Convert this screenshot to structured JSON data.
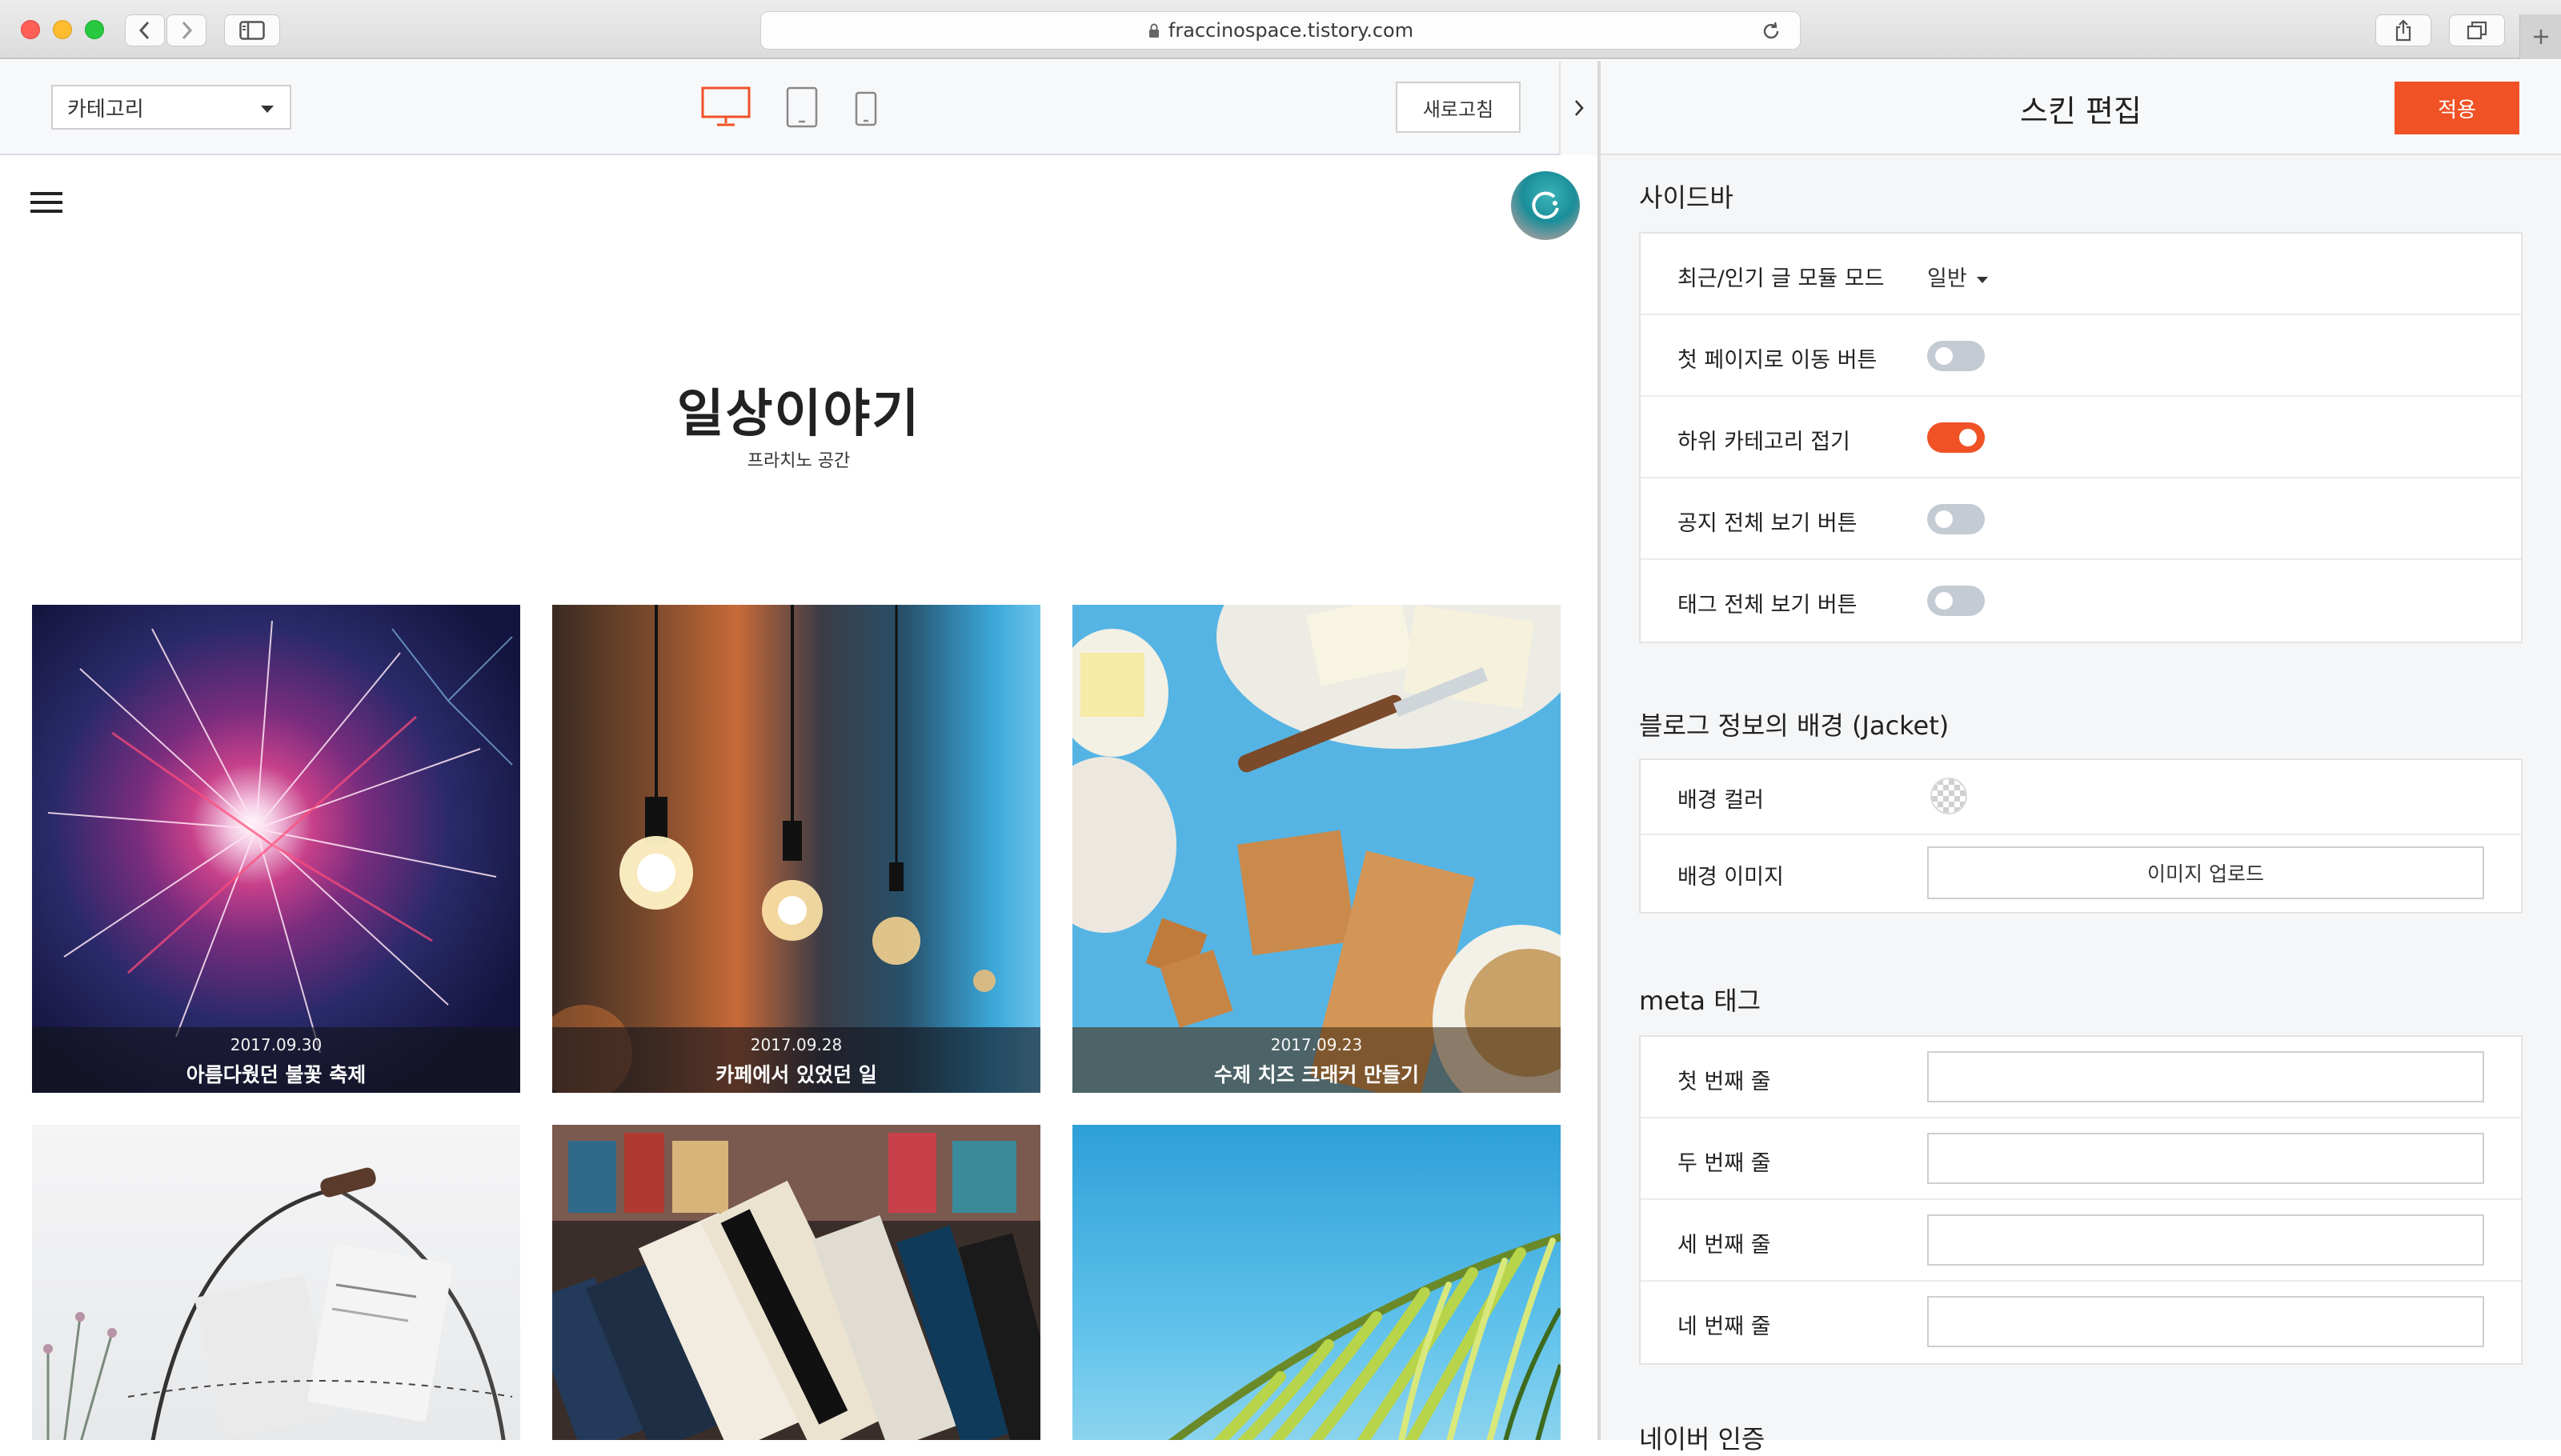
{
  "browser": {
    "url": "fraccinospace.tistory.com"
  },
  "preview": {
    "category_select": "카테고리",
    "refresh_label": "새로고침",
    "blog_title": "일상이야기",
    "blog_subtitle": "프라치노 공간",
    "posts": [
      {
        "date": "2017.09.30",
        "title": "아름다웠던 불꽃 축제",
        "image": "fireworks"
      },
      {
        "date": "2017.09.28",
        "title": "카페에서 있었던 일",
        "image": "cafe-lightbulbs"
      },
      {
        "date": "2017.09.23",
        "title": "수제 치즈 크래커 만들기",
        "image": "cheese-crackers"
      },
      {
        "date": "",
        "title": "",
        "image": "wire-basket"
      },
      {
        "date": "",
        "title": "",
        "image": "books"
      },
      {
        "date": "",
        "title": "",
        "image": "palm-leaf"
      }
    ]
  },
  "editor": {
    "title": "스킨 편집",
    "apply_label": "적용",
    "sidebar": {
      "title": "사이드바",
      "rows": [
        {
          "label": "최근/인기 글 모듈 모드",
          "value": "일반"
        },
        {
          "label": "첫 페이지로 이동 버튼",
          "on": false
        },
        {
          "label": "하위 카테고리 접기",
          "on": true
        },
        {
          "label": "공지 전체 보기 버튼",
          "on": false
        },
        {
          "label": "태그 전체 보기 버튼",
          "on": false
        }
      ]
    },
    "jacket": {
      "title": "블로그 정보의 배경 (Jacket)",
      "color_label": "배경 컬러",
      "image_label": "배경 이미지",
      "upload_label": "이미지 업로드"
    },
    "meta": {
      "title": "meta 태그",
      "rows": [
        {
          "label": "첫 번째 줄",
          "value": ""
        },
        {
          "label": "두 번째 줄",
          "value": ""
        },
        {
          "label": "세 번째 줄",
          "value": ""
        },
        {
          "label": "네 번째 줄",
          "value": ""
        }
      ]
    },
    "next_section_title": "네이버 인증"
  },
  "colors": {
    "accent": "#f05226",
    "toggle_off": "#c5cbd3",
    "device_active": "#f05226"
  },
  "icons": [
    "back-icon",
    "forward-icon",
    "sidebar-icon",
    "lock-icon",
    "reload-icon",
    "share-icon",
    "tabs-icon",
    "plus-icon",
    "desktop-icon",
    "tablet-icon",
    "mobile-icon",
    "chevron-right-icon",
    "menu-icon"
  ]
}
